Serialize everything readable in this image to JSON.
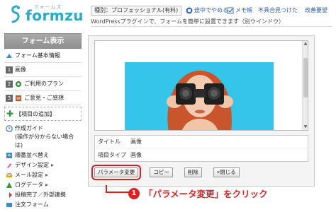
{
  "header": {
    "logo_kana": "フォームズ",
    "logo_name": "formzu",
    "plan_label": "種別：プロフェッショナル(有料)",
    "links": [
      {
        "label": "途中でやめる",
        "icon": "stop-icon"
      },
      {
        "label": "メモ帳",
        "icon": "memo-icon"
      },
      {
        "label": "不具合見つけた"
      },
      {
        "label": "改善要望"
      }
    ],
    "notice": "WordPressプラグインで、フォームを簡単に設置できます（別ウインドウ）"
  },
  "sidebar": {
    "title": "フォーム表示",
    "items": [
      {
        "label": "フォーム基本情報",
        "icon": "form-info-icon"
      },
      {
        "label": "画像",
        "num": "1"
      },
      {
        "label": "ご利用のプラン",
        "num": "2"
      },
      {
        "label": "ご意見・ご感想",
        "num": "3"
      },
      {
        "label": "【項目の追加】",
        "icon": "plus-icon"
      }
    ],
    "menu": [
      {
        "label": "作成ガイド",
        "sub": "(操作が分からない場合は)",
        "icon": "guide-icon"
      },
      {
        "label": "順番並べ替え",
        "icon": "sort-icon"
      },
      {
        "label": "デザイン設定",
        "icon": "design-icon"
      },
      {
        "label": "メール設定",
        "icon": "mail-icon"
      },
      {
        "label": "ログデータ",
        "icon": "log-icon"
      },
      {
        "label": "投稿完了／外部連携",
        "icon": "link-icon"
      },
      {
        "label": "注文フォーム",
        "icon": "order-icon"
      }
    ]
  },
  "editor": {
    "info": [
      {
        "key": "タイトル",
        "value": "画像"
      },
      {
        "key": "項目タイプ",
        "value": "画像"
      }
    ],
    "buttons": {
      "change_params": "パラメータ変更",
      "copy": "コピー",
      "delete": "削除",
      "close": "×閉じる"
    }
  },
  "callout": {
    "number": "1",
    "text": "「パラメータ変更」をクリック"
  },
  "colors": {
    "brand": "#2aa9c9",
    "highlight": "#e02020",
    "photo_bg": "#35c5ea"
  }
}
